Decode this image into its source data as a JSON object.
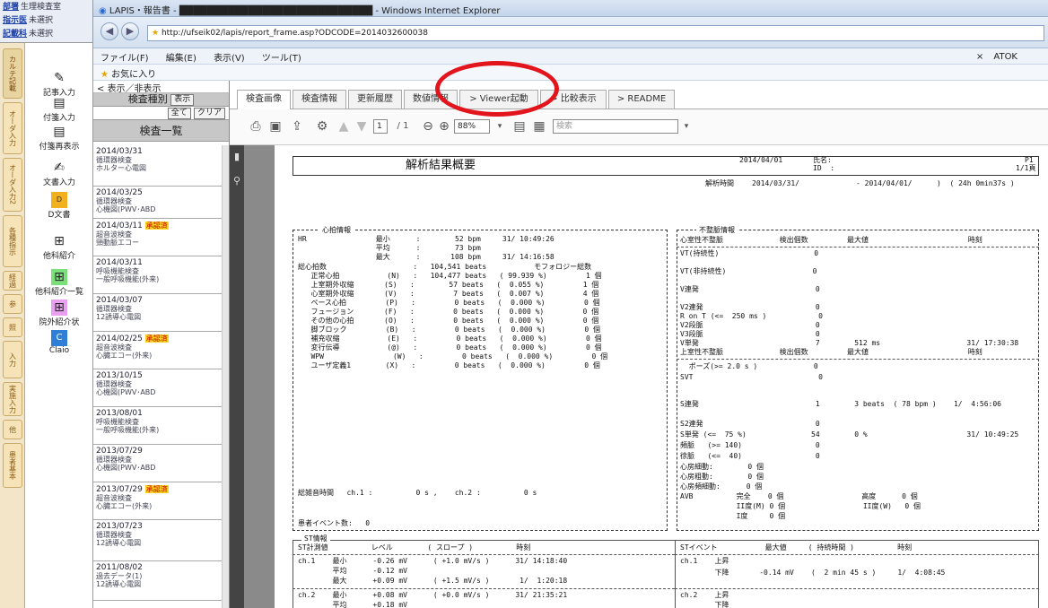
{
  "top_left": {
    "row1_key": "部署",
    "row1_val": "生理検査室",
    "row2_key": "指示医",
    "row2_val": "未選択",
    "row3_key": "記載科",
    "row3_val": "未選択"
  },
  "vtabs": [
    "カルテ記載",
    "オーダ入力",
    "オーダ入力2",
    "各種指示",
    "経過",
    "参",
    "照",
    "入力",
    "実施入力",
    "他",
    "患者基本"
  ],
  "menu": [
    {
      "label": "記事入力",
      "icon": "✎"
    },
    {
      "label": "付箋入力",
      "icon": "▤"
    },
    {
      "label": "付箋再表示",
      "icon": "▤"
    },
    {
      "label": "文書入力",
      "icon": "✍"
    },
    {
      "label": "D文書",
      "icon": "D"
    },
    {
      "label": "他科紹介",
      "icon": "⊞"
    },
    {
      "label": "他科紹介一覧",
      "icon": "⊞"
    },
    {
      "label": "院外紹介状",
      "icon": "⊞"
    },
    {
      "label": "Claio",
      "icon": "C"
    }
  ],
  "window": {
    "title": "LAPIS・報告書 - ████████████████████████████ - Windows Internet Explorer",
    "url": "http://ufseik02/lapis/report_frame.asp?ODCODE=2014032600038",
    "menus": [
      "ファイル(F)",
      "編集(E)",
      "表示(V)",
      "ツール(T)"
    ],
    "favorites": "お気に入り",
    "atok": "ATOK"
  },
  "list": {
    "toggle": "表示／非表示",
    "kind_label": "検査種別",
    "show_btn": "表示",
    "all_btn": "全て",
    "clear_btn": "クリア",
    "header": "検査一覧",
    "items": [
      {
        "date": "2014/03/31",
        "badge": "",
        "l1": "循環器検査",
        "l2": "ホルター心電図"
      },
      {
        "date": "2014/03/25",
        "badge": "",
        "l1": "循環器検査",
        "l2": "心機図(PWV･ABD"
      },
      {
        "date": "2014/03/11",
        "badge": "承認済",
        "l1": "超音波検査",
        "l2": "頸動脈エコー"
      },
      {
        "date": "2014/03/11",
        "badge": "",
        "l1": "呼吸機能検査",
        "l2": "一般呼吸機能(外来)"
      },
      {
        "date": "2014/03/07",
        "badge": "",
        "l1": "循環器検査",
        "l2": "12誘導心電図"
      },
      {
        "date": "2014/02/25",
        "badge": "承認済",
        "l1": "超音波検査",
        "l2": "心臓エコー(外来)"
      },
      {
        "date": "2013/10/15",
        "badge": "",
        "l1": "循環器検査",
        "l2": "心機図(PWV･ABD"
      },
      {
        "date": "2013/08/01",
        "badge": "",
        "l1": "呼吸機能検査",
        "l2": "一般呼吸機能(外来)"
      },
      {
        "date": "2013/07/29",
        "badge": "",
        "l1": "循環器検査",
        "l2": "心機図(PWV･ABD"
      },
      {
        "date": "2013/07/29",
        "badge": "承認済",
        "l1": "超音波検査",
        "l2": "心臓エコー(外来)"
      },
      {
        "date": "2013/07/23",
        "badge": "",
        "l1": "循環器検査",
        "l2": "12誘導心電図"
      },
      {
        "date": "2011/08/02",
        "badge": "",
        "l1": "過去データ(1)",
        "l2": "12誘導心電図"
      }
    ]
  },
  "tabs": [
    "検査画像",
    "検査情報",
    "更新履歴",
    "数値情報",
    "> Viewer起動",
    "> 比較表示",
    "> README"
  ],
  "toolbar": {
    "page": "1",
    "pages": "/ 1",
    "zoom": "88%",
    "search": "検索"
  },
  "report": {
    "title": "解析結果概要",
    "date": "2014/04/01",
    "name_label": "氏名:",
    "id_label": "ID  :",
    "page": "P1",
    "page_of": "1/1頁",
    "period_label": "解析時間",
    "period_start": "2014/03/31/",
    "period_end": "- 2014/04/01/",
    "period_len": ")  ( 24h 0min37s )",
    "hr_section": "心拍情報",
    "hr_rows": [
      "HR                最小      :        52 bpm     31/ 10:49:26",
      "                  平均      :        73 bpm",
      "                  最大      :       108 bpm     31/ 14:16:58",
      "総心拍数                    :   104,541 beats           モフォロジー総数",
      "   正常心拍           (N)   :   104,477 beats   ( 99.939 %)         1 個",
      "   上室期外収縮       (S)   :        57 beats   (  0.055 %)         1 個",
      "   心室期外収縮       (V)   :         7 beats   (  0.007 %)         4 個",
      "   ペース心拍         (P)   :         0 beats   (  0.000 %)         0 個",
      "   フュージョン       (F)   :         0 beats   (  0.000 %)         0 個",
      "   その他の心拍       (O)   :         0 beats   (  0.000 %)         0 個",
      "   脚ブロック         (B)   :         0 beats   (  0.000 %)         0 個",
      "   補充収縮           (E)   :         0 beats   (  0.000 %)         0 個",
      "   変行伝導           (@)   :         0 beats   (  0.000 %)         0 個",
      "   WPW                (W)   :         0 beats   (  0.000 %)         0 個",
      "   ユーザ定義1        (X)   :         0 beats   (  0.000 %)         0 個"
    ],
    "noise_line": "総雑音時間   ch.1 :          0 s ,    ch.2 :          0 s",
    "event_line": "患者イベント数:   0",
    "arr_section": "不整脈情報",
    "arr_v_header": "心室性不整脈             検出個数         最大値                       時刻",
    "arr_v_rows": [
      "VT(持続性)                      0",
      "VT(非持続性)                    0",
      "V連発                           0",
      "V2連発                          0",
      "R on T (<=  250 ms )            0",
      "V2段脈                          0",
      "V3段脈                          0",
      "V単発                           7        512 ms                    31/ 17:30:38"
    ],
    "arr_s_header": "上室性不整脈             検出個数         最大値                       時刻",
    "arr_s_rows": [
      "  ポーズ(>= 2.0 s )             0",
      "SVT                             0",
      "S連発                           1        3 beats  ( 78 bpm )    1/  4:56:06",
      "S2連発                          0",
      "S単発 (<=  75 %)               54        0 %                       31/ 10:49:25",
      "頻脈   (>= 140)                 0",
      "徐脈   (<=  40)                 0",
      "心房細動:        0 個",
      "心房粗動:        0 個",
      "心房頻細動:      0 個",
      "AVB          完全    0 個                  高度      0 個",
      "             II度(M) 0 個                  II度(W)   0 個",
      "             I度     0 個"
    ],
    "st_section": "ST情報",
    "st_header": "ST計測値          レベル        ( スロープ )          時刻",
    "st_rows": [
      "ch.1    最小      -0.26 mV      ( +1.0 mV/s )      31/ 14:18:40",
      "        平均      -0.12 mV",
      "        最大      +0.09 mV      ( +1.5 mV/s )       1/  1:20:18",
      "ch.2    最小      +0.08 mV      ( +0.0 mV/s )      31/ 21:35:21",
      "        平均      +0.18 mV"
    ],
    "stev_header": "STイベント           最大値     ( 持続時間 )          時刻",
    "stev_rows": [
      "ch.1    上昇",
      "        下降       -0.14 mV    (  2 min 45 s )     1/  4:08:45",
      "",
      "ch.2    上昇",
      "        下降"
    ]
  }
}
